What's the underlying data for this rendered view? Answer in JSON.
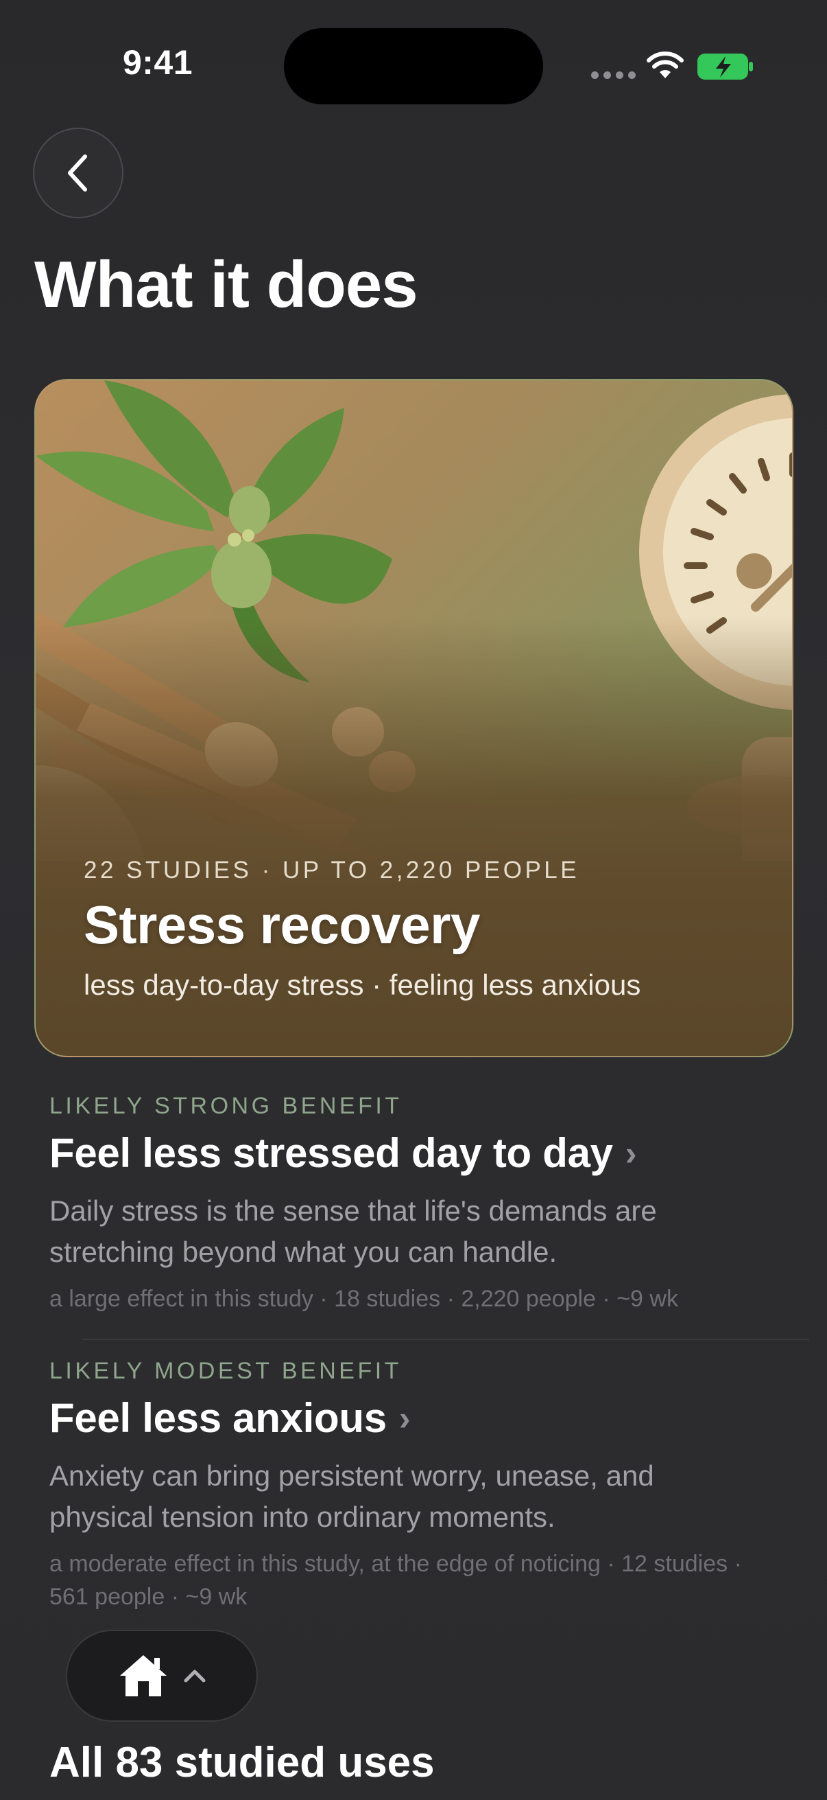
{
  "status_bar": {
    "time": "9:41"
  },
  "header": {
    "title": "What it does"
  },
  "hero": {
    "meta": "22 STUDIES · UP TO 2,220 PEOPLE",
    "title": "Stress recovery",
    "subtitle": "less day-to-day stress · feeling less anxious"
  },
  "benefits": [
    {
      "tag": "LIKELY STRONG BENEFIT",
      "title": "Feel less stressed day to day",
      "description": "Daily stress is the sense that life's demands are stretching beyond what you can handle.",
      "stats": "a large effect in this study · 18 studies · 2,220 people · ~9 wk"
    },
    {
      "tag": "LIKELY MODEST BENEFIT",
      "title": "Feel less anxious",
      "description": "Anxiety can bring persistent worry, unease, and physical tension into ordinary moments.",
      "stats": "a moderate effect in this study, at the edge of noticing · 12 studies · 561 people · ~9 wk"
    }
  ],
  "section": {
    "title": "All 83 studied uses"
  },
  "colors": {
    "background": "#2c2c2e",
    "benefit_tag": "#8fa58c",
    "battery_green": "#34c759"
  },
  "icons": [
    "back-chevron-icon",
    "wifi-icon",
    "battery-charging-icon",
    "home-icon",
    "chevron-up-icon",
    "chevron-right-icon"
  ]
}
